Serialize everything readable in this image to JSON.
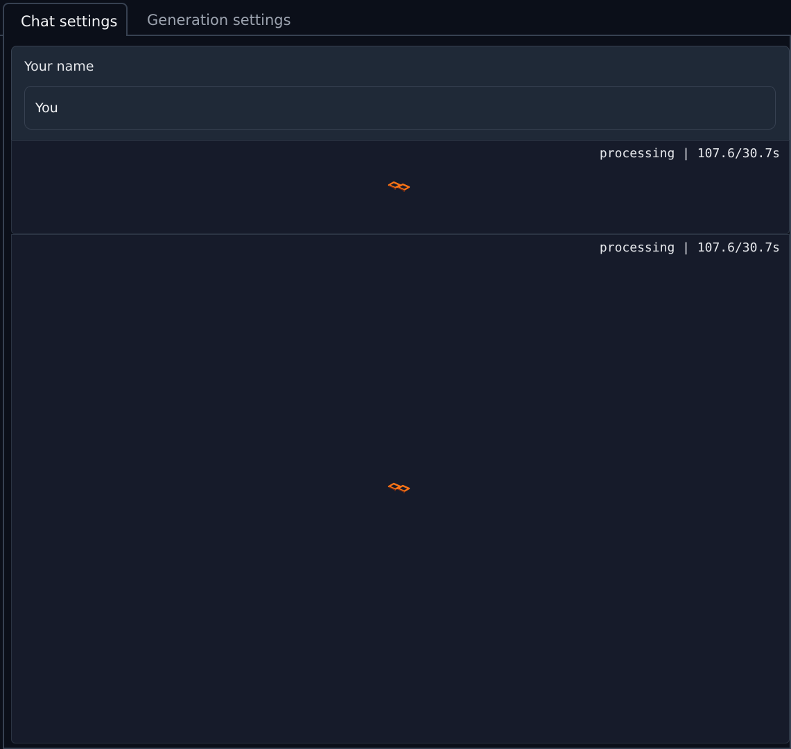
{
  "tabs": [
    {
      "label": "Chat settings",
      "active": true
    },
    {
      "label": "Generation settings",
      "active": false
    }
  ],
  "name_field": {
    "label": "Your name",
    "value": "You"
  },
  "progress": [
    {
      "status": "processing | 107.6/30.7s",
      "icon": "loading-spinner-icon"
    },
    {
      "status": "processing | 107.6/30.7s",
      "icon": "loading-spinner-icon"
    }
  ],
  "colors": {
    "background": "#0b0f19",
    "panel": "#1f2937",
    "border": "#374151",
    "loader_accent": "#f97316"
  }
}
